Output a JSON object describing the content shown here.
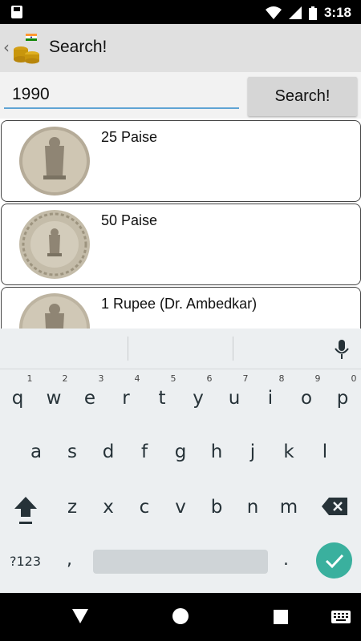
{
  "status_bar": {
    "time": "3:18"
  },
  "app_bar": {
    "title": "Search!"
  },
  "search": {
    "query": "1990",
    "button_label": "Search!"
  },
  "results": [
    {
      "name": "25 Paise"
    },
    {
      "name": "50 Paise"
    },
    {
      "name": "1 Rupee (Dr. Ambedkar)"
    }
  ],
  "keyboard": {
    "row1": [
      "q",
      "w",
      "e",
      "r",
      "t",
      "y",
      "u",
      "i",
      "o",
      "p"
    ],
    "row1_hints": [
      "1",
      "2",
      "3",
      "4",
      "5",
      "6",
      "7",
      "8",
      "9",
      "0"
    ],
    "row2": [
      "a",
      "s",
      "d",
      "f",
      "g",
      "h",
      "j",
      "k",
      "l"
    ],
    "row3": [
      "z",
      "x",
      "c",
      "v",
      "b",
      "n",
      "m"
    ],
    "symbols_label": "?123",
    "comma": ",",
    "period": "."
  },
  "colors": {
    "accent": "#3ab09e",
    "input_underline": "#5fa4d4",
    "app_bar": "#e0e0e0"
  }
}
